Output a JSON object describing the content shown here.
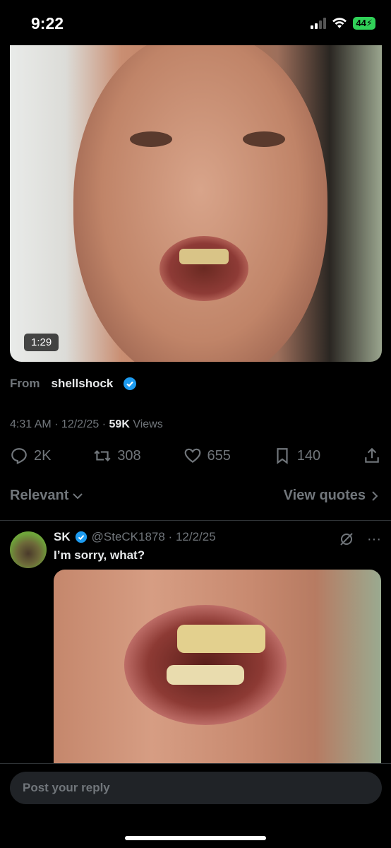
{
  "status_bar": {
    "time": "9:22",
    "battery": "44"
  },
  "main_post": {
    "video_duration": "1:29",
    "from_label": "From",
    "from_user": "shellshock",
    "meta_time": "4:31 AM · 12/2/25 · ",
    "views_count": "59K",
    "views_label": "Views",
    "actions": {
      "replies": "2K",
      "reposts": "308",
      "likes": "655",
      "bookmarks": "140"
    }
  },
  "filter": {
    "sort_label": "Relevant",
    "quotes_label": "View quotes"
  },
  "reply": {
    "name": "SK",
    "handle_date": "@SteCK1878 · 12/2/25",
    "text": "I’m sorry, what?"
  },
  "composer": {
    "placeholder": "Post your reply"
  },
  "colors": {
    "verified": "#1d9bf0",
    "muted": "#71767b",
    "background": "#000000"
  }
}
